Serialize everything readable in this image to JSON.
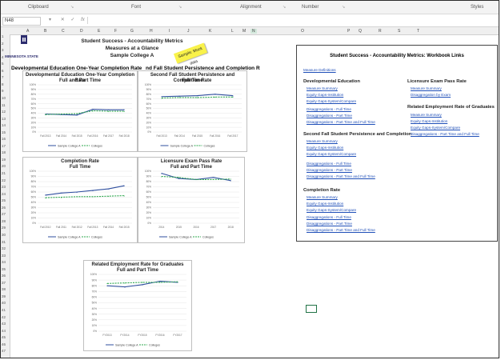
{
  "ribbon": {
    "groups": [
      "Clipboard",
      "Font",
      "Alignment",
      "Number",
      "Styles"
    ]
  },
  "formula_bar": {
    "name_box": "N48",
    "icons": [
      "dropdown-icon",
      "cancel-icon",
      "confirm-icon",
      "fx-icon"
    ]
  },
  "columns": [
    "A",
    "B",
    "C",
    "D",
    "E",
    "F",
    "G",
    "H",
    "I",
    "J",
    "K",
    "L",
    "M",
    "N",
    "O",
    "P",
    "Q",
    "R",
    "S",
    "T"
  ],
  "rows": [
    "1",
    "2",
    "3",
    "4",
    "5",
    "6",
    "7",
    "8",
    "9",
    "10",
    "11",
    "12",
    "13",
    "14",
    "15",
    "16",
    "17",
    "18",
    "19",
    "20",
    "21",
    "22",
    "23",
    "24",
    "25",
    "26",
    "27",
    "28",
    "29",
    "30",
    "31",
    "32",
    "33",
    "34",
    "35",
    "36",
    "37",
    "38",
    "39",
    "40",
    "41",
    "42",
    "43",
    "44",
    "45",
    "46",
    "47"
  ],
  "header": {
    "title": "Student Success - Accountability Metrics",
    "subtitle": "Measures at a Glance",
    "college": "Sample College A",
    "logo_text": "MINNESOTA STATE",
    "sticky": "Sample: Mock data"
  },
  "banner": "Developmental Education One-Year Completion Rate",
  "banner2": "nd Fall Student Persistence and Completion R",
  "chart_data": [
    {
      "type": "line",
      "title": "Developmental Education One-Year Completion Rate",
      "subtitle": "Full and Part Time",
      "ylim": [
        0,
        100
      ],
      "yticks": [
        "100%",
        "90%",
        "80%",
        "70%",
        "60%",
        "50%",
        "40%",
        "30%",
        "20%",
        "10%",
        "0%"
      ],
      "categories": [
        "Fall 2013",
        "Fall 2014",
        "Fall 2015",
        "Fall 2016",
        "Fall 2017",
        "Fall 2018"
      ],
      "series": [
        {
          "name": "Sample College A",
          "color": "#2f4f9f",
          "values": [
            38,
            37,
            36,
            48,
            47,
            47
          ]
        },
        {
          "name": "Colleges",
          "color": "#2fa84f",
          "values": [
            37,
            38,
            39,
            45,
            44,
            44
          ]
        }
      ]
    },
    {
      "type": "line",
      "title": "Second Fall Student Persistence and Completion Rate",
      "subtitle": "Full Time",
      "ylim": [
        0,
        100
      ],
      "yticks": [
        "100%",
        "90%",
        "80%",
        "70%",
        "60%",
        "50%",
        "40%",
        "30%",
        "20%",
        "10%",
        "0%"
      ],
      "categories": [
        "Fall 2013",
        "Fall 2014",
        "Fall 2015",
        "Fall 2016",
        "Fall 2017"
      ],
      "series": [
        {
          "name": "Sample College A",
          "color": "#2f4f9f",
          "values": [
            75,
            76,
            77,
            80,
            77
          ]
        },
        {
          "name": "Colleges",
          "color": "#2fa84f",
          "values": [
            72,
            73,
            73,
            74,
            74
          ]
        }
      ]
    },
    {
      "type": "line",
      "title": "Completion Rate",
      "subtitle": "Full Time",
      "ylim": [
        0,
        100
      ],
      "yticks": [
        "100%",
        "90%",
        "80%",
        "70%",
        "60%",
        "50%",
        "40%",
        "30%",
        "20%",
        "10%",
        "0%"
      ],
      "categories": [
        "Fall 2010",
        "Fall 2011",
        "Fall 2012",
        "Fall 2013",
        "Fall 2014",
        "Fall 2015"
      ],
      "series": [
        {
          "name": "Sample College A",
          "color": "#2f4f9f",
          "values": [
            54,
            58,
            60,
            63,
            66,
            72
          ]
        },
        {
          "name": "Colleges",
          "color": "#2fa84f",
          "values": [
            49,
            50,
            51,
            51,
            52,
            53
          ]
        }
      ]
    },
    {
      "type": "line",
      "title": "Licensure Exam Pass Rate",
      "subtitle": "Full and Part Time",
      "ylim": [
        0,
        100
      ],
      "yticks": [
        "100%",
        "90%",
        "80%",
        "70%",
        "60%",
        "50%",
        "40%",
        "30%",
        "20%",
        "10%",
        "0%"
      ],
      "categories": [
        "2014",
        "2015",
        "2016",
        "2017",
        "2018"
      ],
      "series": [
        {
          "name": "Sample College A",
          "color": "#2f4f9f",
          "values": [
            96,
            86,
            84,
            88,
            82
          ]
        },
        {
          "name": "Colleges",
          "color": "#2fa84f",
          "values": [
            90,
            88,
            84,
            84,
            85
          ]
        }
      ]
    },
    {
      "type": "line",
      "title": "Related Employment Rate for Graduates",
      "subtitle": "Full and Part Time",
      "ylim": [
        0,
        100
      ],
      "yticks": [
        "100%",
        "90%",
        "80%",
        "70%",
        "60%",
        "50%",
        "40%",
        "30%",
        "20%",
        "10%",
        "0%"
      ],
      "categories": [
        "FY2013",
        "FY2014",
        "FY2015",
        "FY2016",
        "FY2017"
      ],
      "series": [
        {
          "name": "Sample College A",
          "color": "#2f4f9f",
          "values": [
            80,
            78,
            82,
            88,
            86
          ]
        },
        {
          "name": "Colleges",
          "color": "#2fa84f",
          "values": [
            84,
            85,
            86,
            86,
            87
          ]
        }
      ]
    }
  ],
  "links_panel": {
    "title": "Student Success - Accountability Metrics: Workbook Links",
    "definitions": "Measure Definitions",
    "sections": [
      {
        "heading": "Developmental Education",
        "links": [
          "Measure Summary",
          "Equity Gaps-Institution",
          "Equity Gaps-System/Compare",
          "Disaggregations - Full Time",
          "Disaggregations - Part Time",
          "Disaggregations - Part Time and Full Time"
        ]
      },
      {
        "heading": "Second Fall Student Persistence and Completion",
        "links": [
          "Measure Summary",
          "Equity Gaps-Institution",
          "Equity Gaps-System/Compare",
          "Disaggregations - Full Time",
          "Disaggregations - Part Time",
          "Disaggregations - Part Time and Full Time"
        ]
      },
      {
        "heading": "Completion Rate",
        "links": [
          "Measure Summary",
          "Equity Gaps-Institution",
          "Equity Gaps-System/Compare",
          "Disaggregations - Full Time",
          "Disaggregations - Part Time",
          "Disaggregations - Part Time and Full Time"
        ]
      },
      {
        "heading": "Licensure Exam Pass Rate",
        "links": [
          "Measure Summary",
          "Disaggregation by Exam"
        ]
      },
      {
        "heading": "Related Employment Rate of Graduates",
        "links": [
          "Measure Summary",
          "Equity Gaps-Institution",
          "Equity Gaps-System/Compare",
          "Disaggregations - Part Time and Full Time"
        ]
      }
    ]
  }
}
